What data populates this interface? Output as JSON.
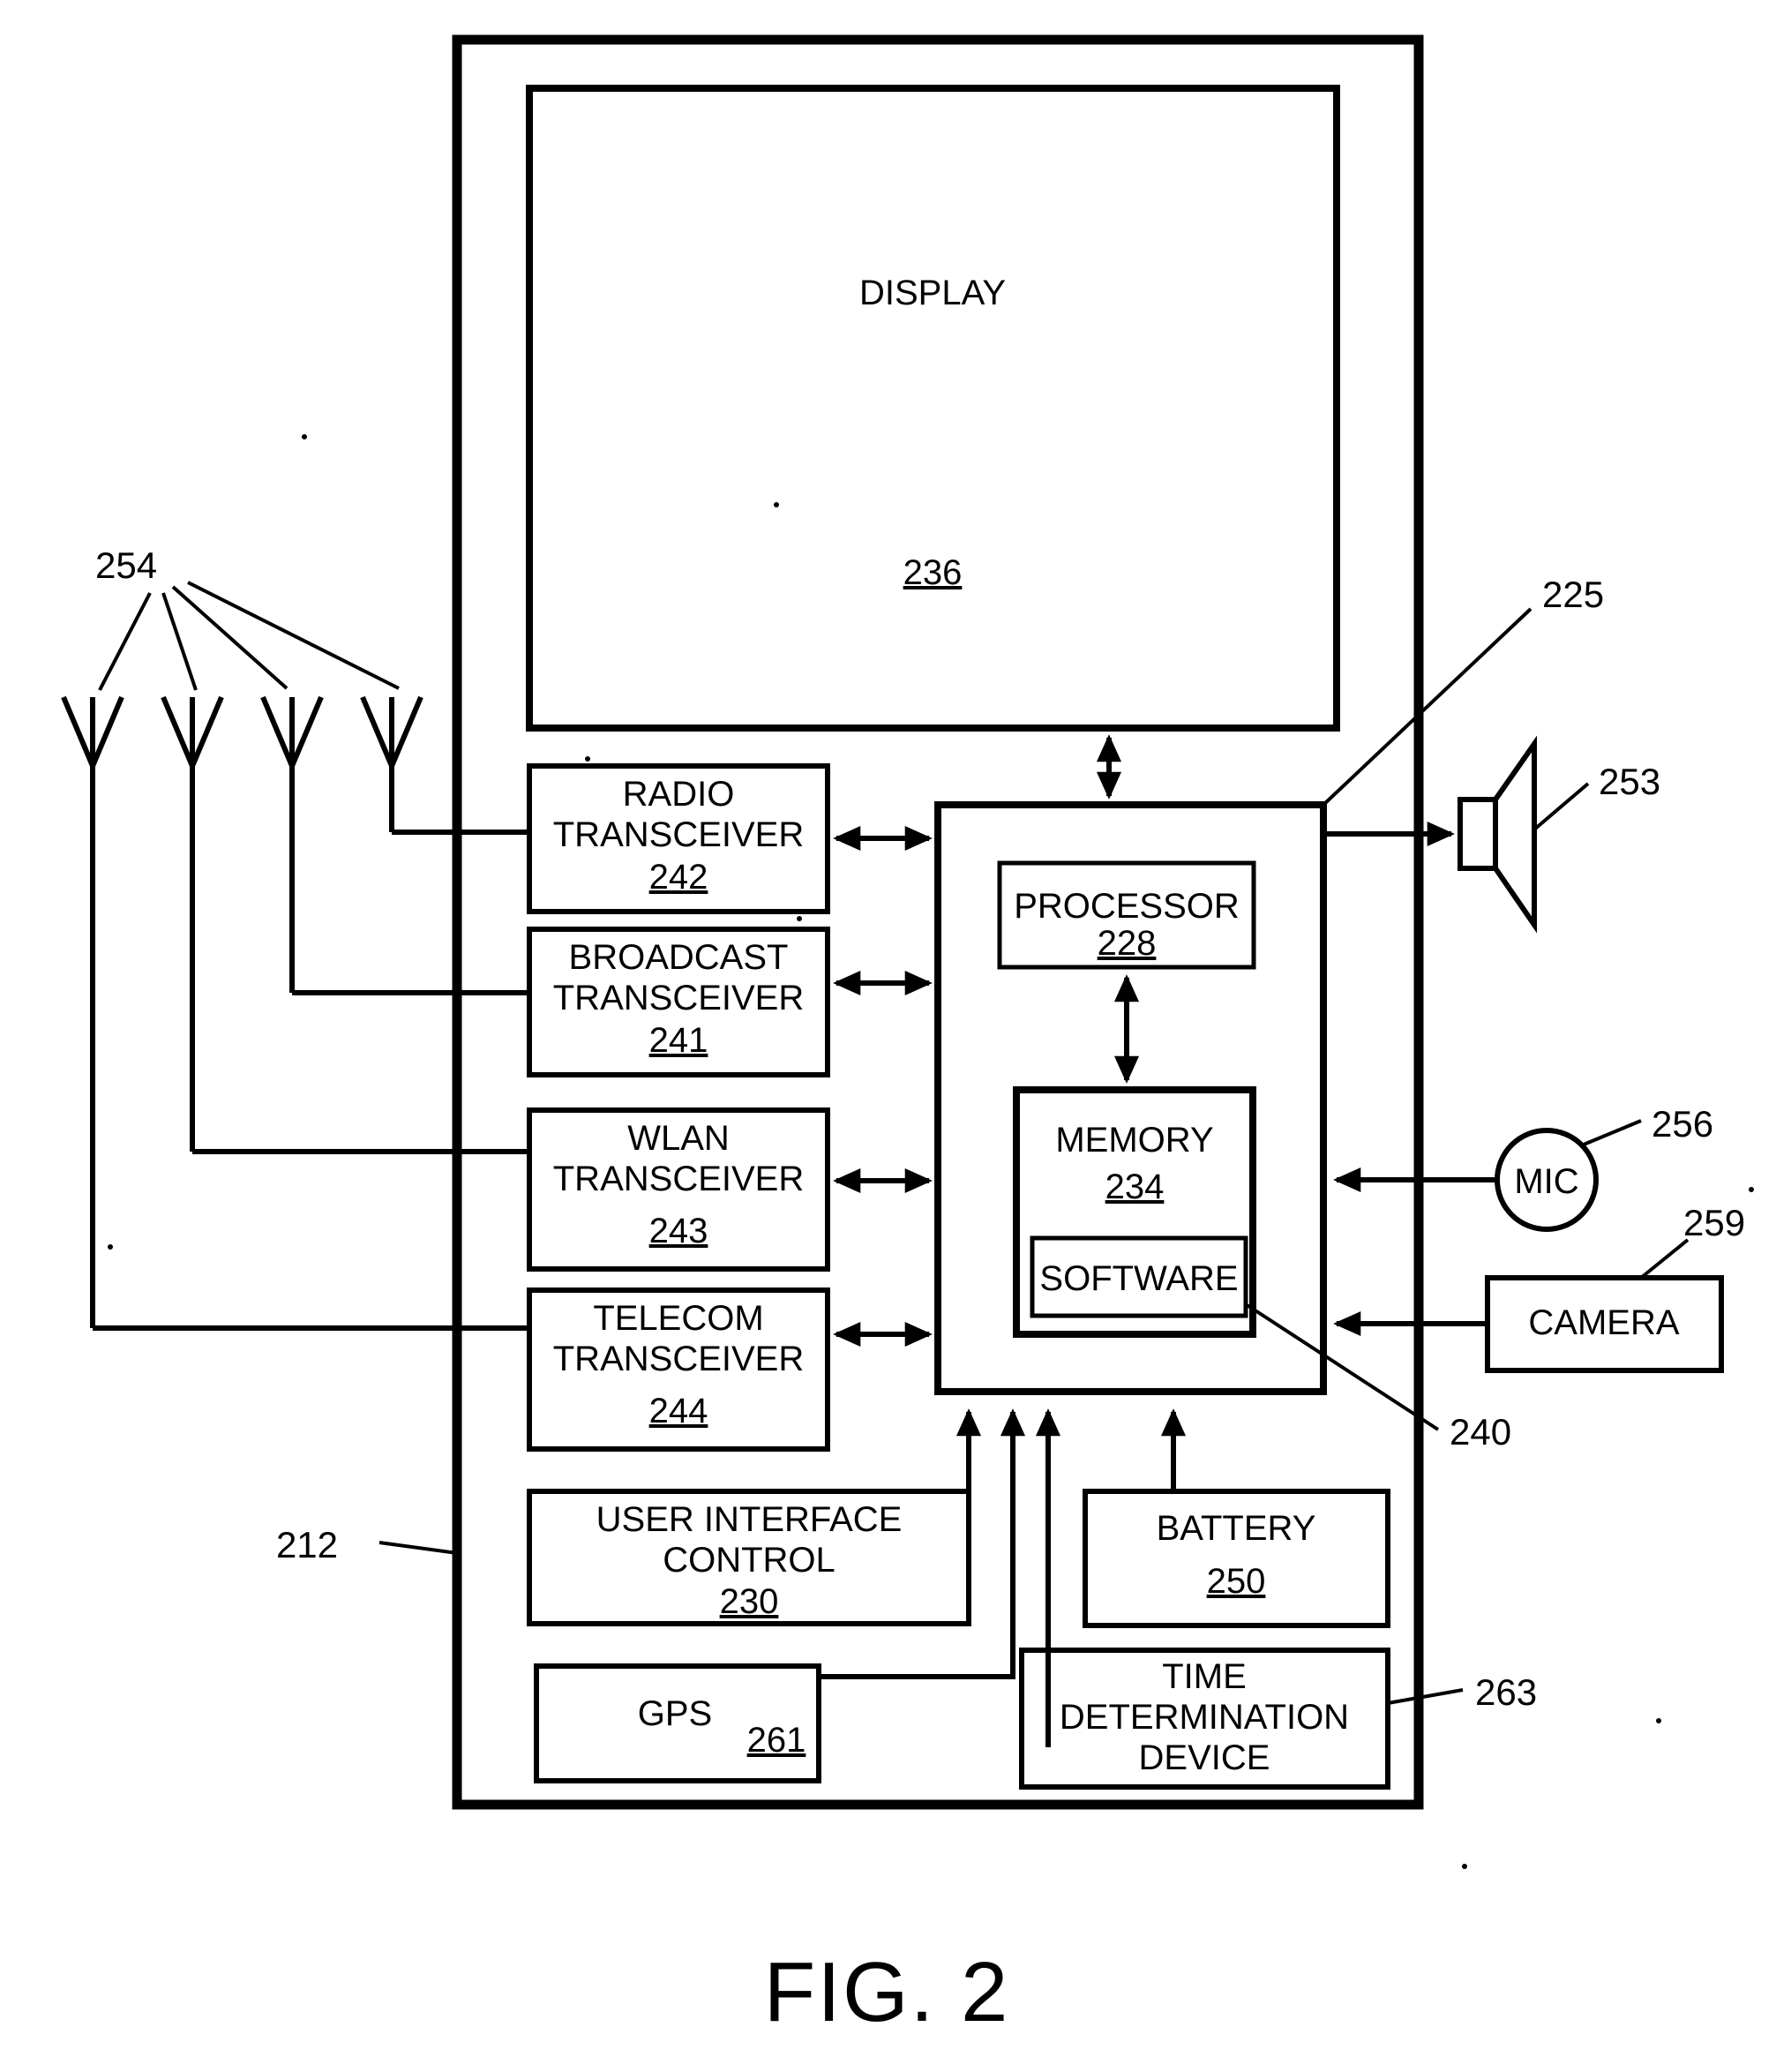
{
  "figure": {
    "caption": "FIG. 2",
    "device_ref": "212"
  },
  "blocks": {
    "display": {
      "label": "DISPLAY",
      "ref": "236"
    },
    "radio": {
      "label_line1": "RADIO",
      "label_line2": "TRANSCEIVER",
      "ref": "242"
    },
    "broadcast": {
      "label_line1": "BROADCAST",
      "label_line2": "TRANSCEIVER",
      "ref": "241"
    },
    "wlan": {
      "label_line1": "WLAN",
      "label_line2": "TRANSCEIVER",
      "ref": "243"
    },
    "telecom": {
      "label_line1": "TELECOM",
      "label_line2": "TRANSCEIVER",
      "ref": "244"
    },
    "ui_control": {
      "label_line1": "USER INTERFACE",
      "label_line2": "CONTROL",
      "ref": "230"
    },
    "gps": {
      "label": "GPS",
      "ref": "261"
    },
    "processor": {
      "label": "PROCESSOR",
      "ref": "228"
    },
    "memory": {
      "label": "MEMORY",
      "ref": "234"
    },
    "software": {
      "label": "SOFTWARE",
      "ref": "240"
    },
    "battery": {
      "label": "BATTERY",
      "ref": "250"
    },
    "time_device": {
      "label_line1": "TIME",
      "label_line2": "DETERMINATION",
      "label_line3": "DEVICE",
      "ref": "263"
    },
    "camera": {
      "label": "CAMERA",
      "ref": "259"
    },
    "mic": {
      "label": "MIC",
      "ref": "256"
    },
    "speaker": {
      "label": "",
      "ref": "253"
    },
    "control_unit": {
      "label": "",
      "ref": "225"
    },
    "antennas": {
      "label": "",
      "ref": "254",
      "count": 4
    }
  },
  "reference_numerals": {
    "r254": "254",
    "r225": "225",
    "r253": "253",
    "r256": "256",
    "r259": "259",
    "r240": "240",
    "r212": "212",
    "r263": "263"
  },
  "colors": {
    "ink": "#000000",
    "paper": "#ffffff"
  }
}
